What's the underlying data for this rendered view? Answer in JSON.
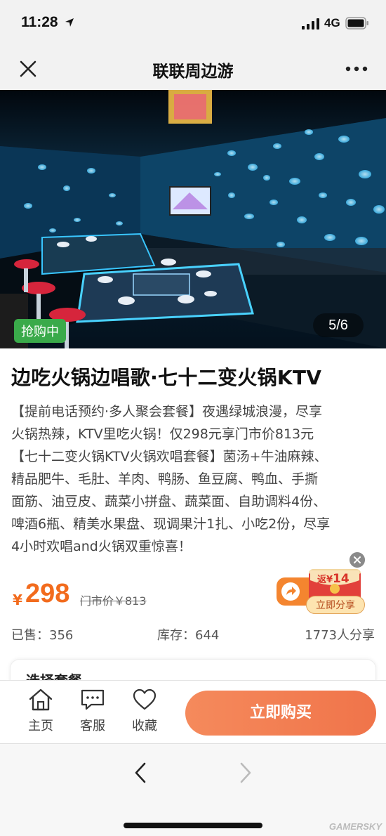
{
  "status_bar": {
    "time": "11:28",
    "network": "4G"
  },
  "nav": {
    "title": "联联周边游"
  },
  "hero": {
    "badge": "抢购中",
    "counter": "5/6"
  },
  "product": {
    "title": "边吃火锅边唱歌·七十二变火锅KTV",
    "description_lines": [
      "【提前电话预约·多人聚会套餐】夜遇绿城浪漫，尽享",
      "火锅热辣，KTV里吃火锅！仅298元享门市价813元",
      "【七十二变火锅KTV火锅欢唱套餐】菌汤+牛油麻辣、",
      "精品肥牛、毛肚、羊肉、鸭肠、鱼豆腐、鸭血、手撕",
      "面筋、油豆皮、蔬菜小拼盘、蔬菜面、自助调料4份、",
      "啤酒6瓶、精美水果盘、现调果汁1扎、小吃2份，尽享",
      "4小时欢唱and火锅双重惊喜！"
    ],
    "currency": "¥",
    "price": "298",
    "original_price": "门市价￥813",
    "sold": "已售：356",
    "stock": "库存：644",
    "shares": "1773人分享"
  },
  "red_packet": {
    "prefix": "返¥",
    "amount": "14",
    "button": "立即分享"
  },
  "package": {
    "label": "选择套餐"
  },
  "action_bar": {
    "home": "主页",
    "service": "客服",
    "favorite": "收藏",
    "buy": "立即购买"
  },
  "watermark": "GAMERSKY",
  "colors": {
    "accent": "#f26b1d",
    "buy_button": "#f0744a",
    "badge": "#3aaa4a"
  }
}
